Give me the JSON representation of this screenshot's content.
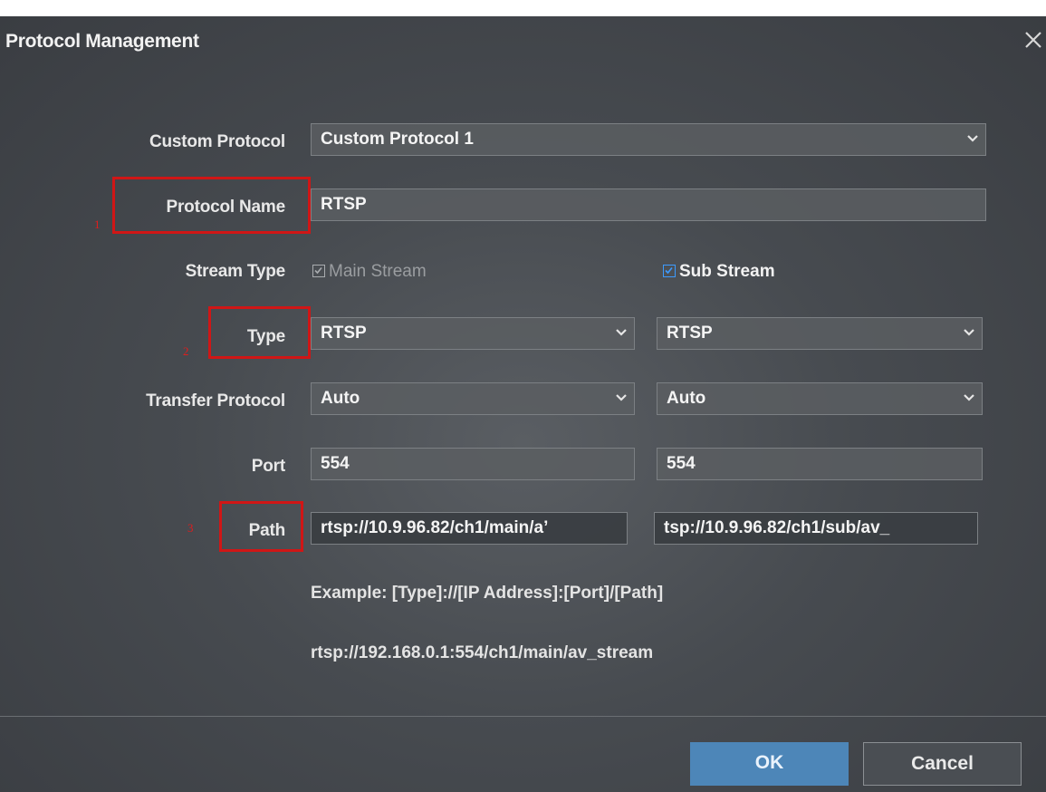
{
  "dialog": {
    "title": "Protocol Management"
  },
  "form": {
    "custom_protocol": {
      "label": "Custom Protocol",
      "value": "Custom Protocol 1"
    },
    "protocol_name": {
      "label": "Protocol Name",
      "value": "RTSP"
    },
    "stream_type": {
      "label": "Stream Type",
      "main": "Main Stream",
      "sub": "Sub Stream"
    },
    "type": {
      "label": "Type",
      "main_value": "RTSP",
      "sub_value": "RTSP"
    },
    "transfer_protocol": {
      "label": "Transfer Protocol",
      "main_value": "Auto",
      "sub_value": "Auto"
    },
    "port": {
      "label": "Port",
      "main_value": "554",
      "sub_value": "554"
    },
    "path": {
      "label": "Path",
      "main_value": "rtsp://10.9.96.82/ch1/main/a’",
      "sub_value": "tsp://10.9.96.82/ch1/sub/av_"
    },
    "example_format": "Example: [Type]://[IP Address]:[Port]/[Path]",
    "example_url": "rtsp://192.168.0.1:554/ch1/main/av_stream"
  },
  "annotations": {
    "n1": "1",
    "n2": "2",
    "n3": "3"
  },
  "buttons": {
    "ok": "OK",
    "cancel": "Cancel"
  },
  "colors": {
    "highlight": "#d01616",
    "accent": "#3d9bff",
    "ok_button": "#4d86b8"
  }
}
